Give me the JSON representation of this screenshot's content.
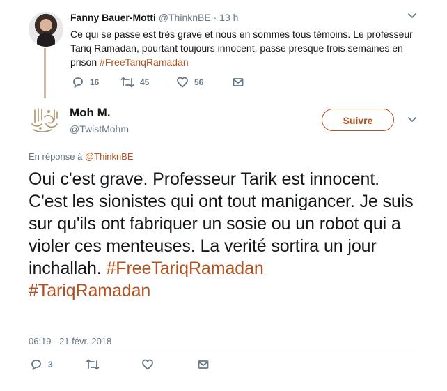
{
  "parent_tweet": {
    "name": "Fanny Bauer-Motti",
    "handle": "@ThinknBE",
    "separator": "·",
    "time": "13 h",
    "text_before": "Ce qui se passe est très grave et nous en sommes tous témoins. Le professeur Tariq Ramadan, pourtant toujours innocent, passe presque trois semaines en prison ",
    "hashtag": "#FreeTariqRamadan",
    "reply_count": "16",
    "retweet_count": "45",
    "like_count": "56"
  },
  "main_tweet": {
    "name": "Moh M.",
    "handle": "@TwistMohm",
    "follow_label": "Suivre",
    "reply_prefix": "En réponse à ",
    "reply_mention": "@ThinknBE",
    "text": "Oui c'est grave. Professeur Tarik est innocent. C'est les sionistes qui ont tout manigancer. Je suis sur qu'ils ont fabriquer un sosie ou un robot qui a violer ces menteuses.  La verité sortira un jour inchallah. ",
    "hashtag1": "#FreeTariqRamadan",
    "hashtag2": "#TariqRamadan",
    "timestamp": "06:19 - 21 févr. 2018",
    "reply_count": "3"
  },
  "colors": {
    "accent": "#b4501f",
    "muted": "#657786",
    "text": "#14171a",
    "divider": "#e6ecf0"
  },
  "icons": [
    "reply-icon",
    "retweet-icon",
    "like-icon",
    "message-icon",
    "chevron-down-icon"
  ]
}
